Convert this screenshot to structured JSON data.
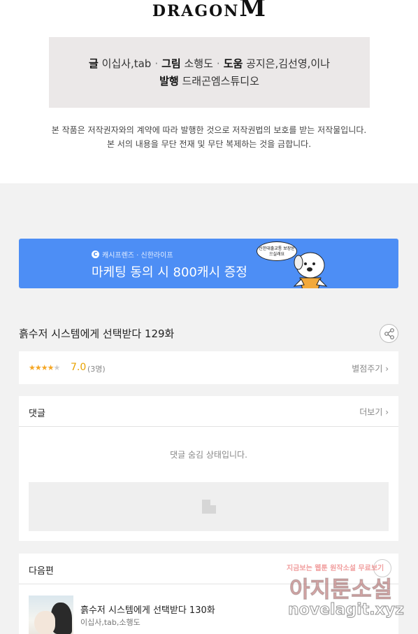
{
  "logo": {
    "text": "DRAGON",
    "mark": "M"
  },
  "credits": {
    "writing_label": "글",
    "writing_value": "이십사,tab",
    "art_label": "그림",
    "art_value": "소행도",
    "assist_label": "도움",
    "assist_value": "공지은,김선영,이나",
    "publish_label": "발행",
    "publish_value": "드래곤엠스튜디오",
    "separator": "·"
  },
  "notice": {
    "line1": "본 작품은 저작권자와의 계약에 따라 발행한 것으로 저작권법의 보호를 받는 저작물입니다.",
    "line2": "본 서의 내용을 무단 전재 및 무단 복제하는 것을 금합니다."
  },
  "banner": {
    "sponsor": "캐시프렌즈 · 신한라이프",
    "headline": "마케팅 동의 시 800캐시 증정",
    "bubble": "신한대출교통 보장받으실래요",
    "colors": {
      "background": "#4d8ef5"
    }
  },
  "episode": {
    "title": "흙수저 시스템에게 선택받다 129화",
    "share_icon": "share-icon"
  },
  "rating": {
    "score_value": 3.5,
    "score": "7.0",
    "count": "(3명)",
    "rate_button": "별점주기 ›"
  },
  "comments": {
    "label": "댓글",
    "more": "더보기 ›",
    "hidden_message": "댓글 숨김 상태입니다."
  },
  "next": {
    "label": "다음편",
    "title": "흙수저 시스템에게 선택받다 130화",
    "author": "이십사,tab,소행도"
  },
  "watermark": {
    "line1": "지금보는 웹툰 원작소설 무료보기",
    "line2": "아지툰소설",
    "line3": "novelagit.xyz"
  }
}
